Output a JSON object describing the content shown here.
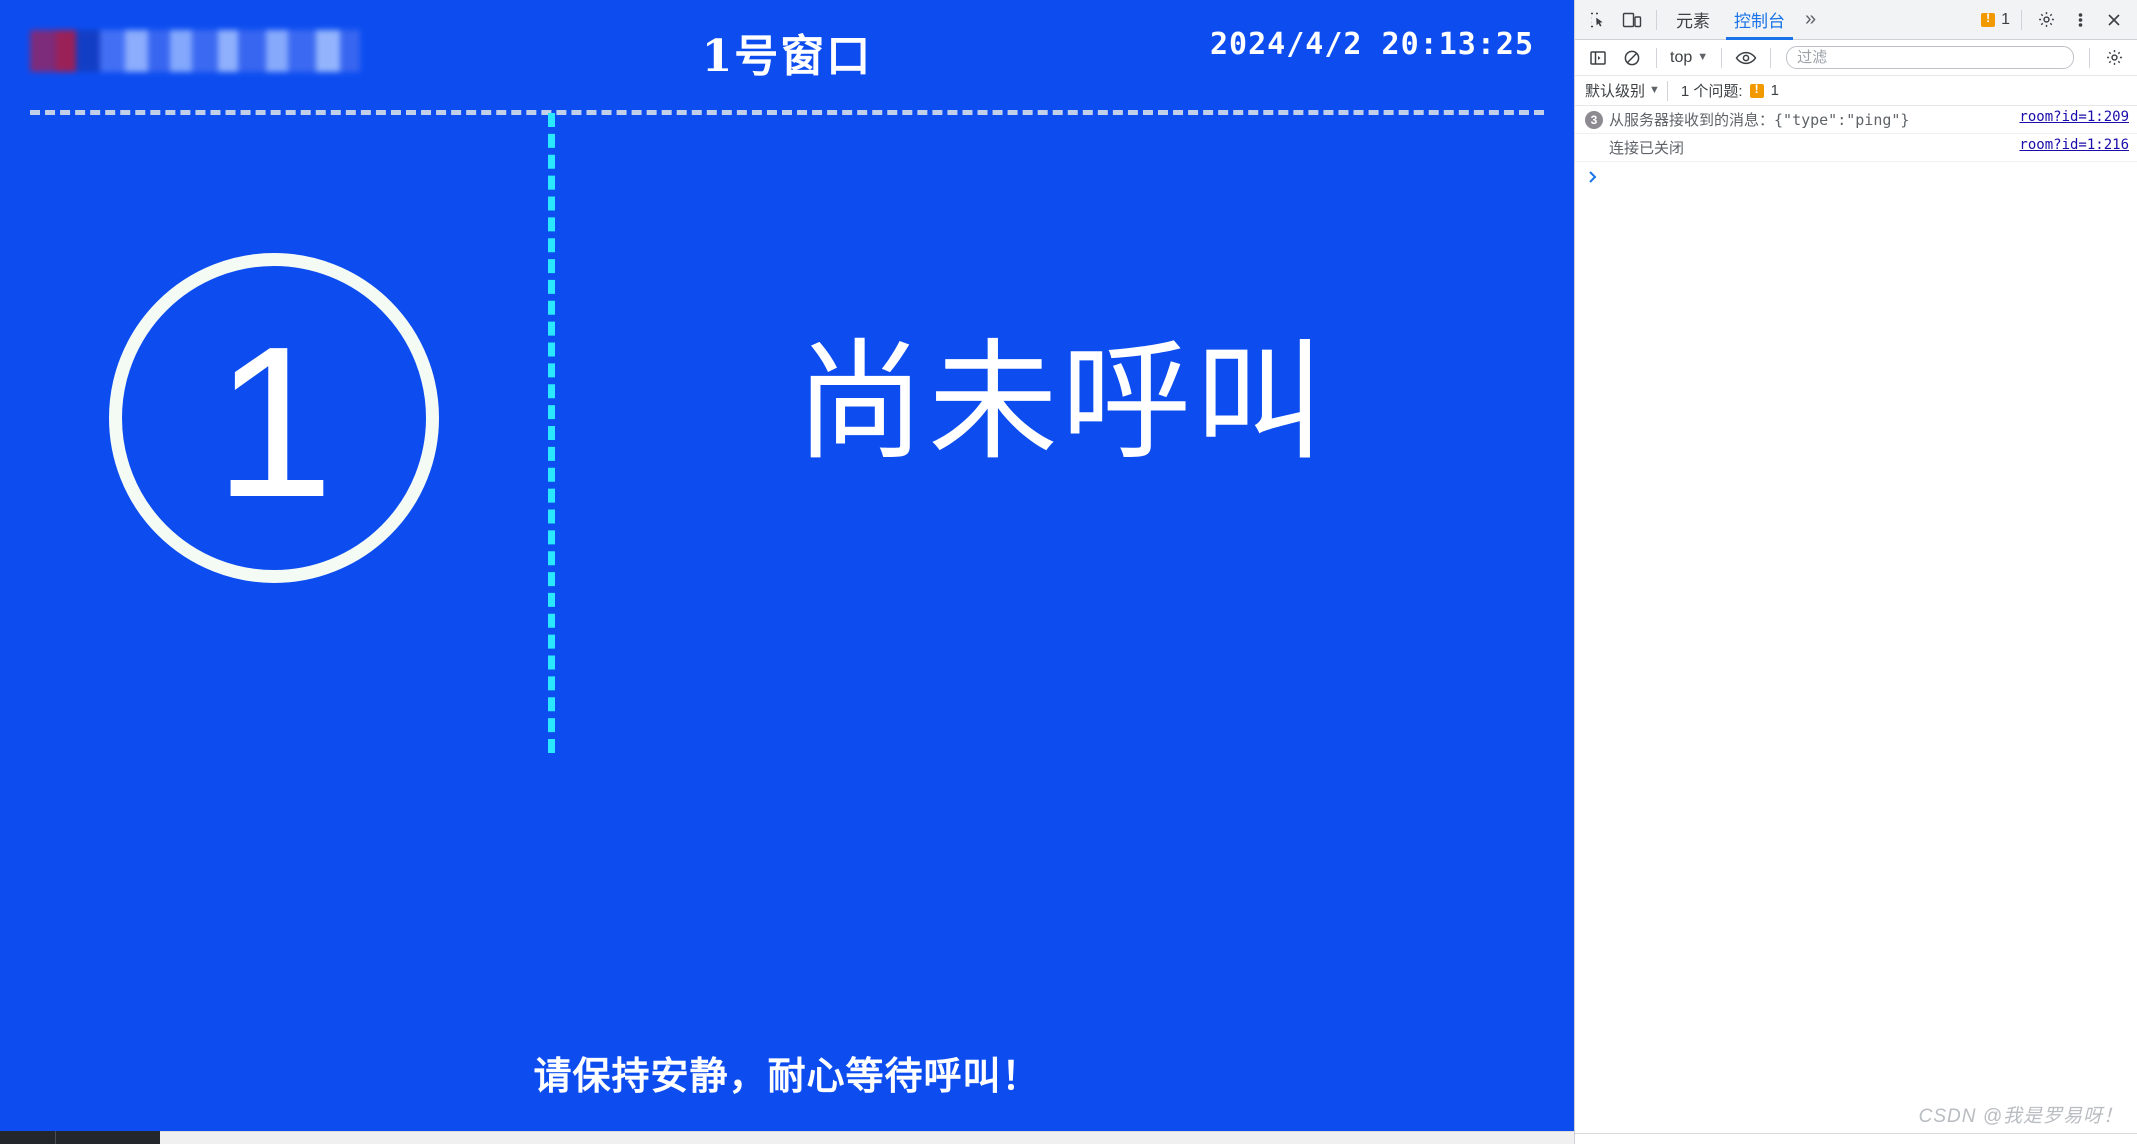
{
  "kiosk": {
    "logo_alt": "blurred-organization-logo",
    "title": "1号窗口",
    "clock": "2024/4/2 20:13:25",
    "queue_number": "1",
    "status_text": "尚未呼叫",
    "footer_notice": "请保持安静，耐心等待呼叫！",
    "colors": {
      "background": "#0d4df0",
      "text": "#ffffff",
      "divider_vertical": "#2ae8ff",
      "divider_horizontal": "#c2cfe8"
    }
  },
  "devtools": {
    "tabbar": {
      "inspect_icon": "inspect-element-icon",
      "device_icon": "device-toolbar-icon",
      "tabs": [
        {
          "label": "元素",
          "active": false
        },
        {
          "label": "控制台",
          "active": true
        }
      ],
      "more_tabs": "»",
      "warning_count": "1",
      "settings_icon": "gear-icon",
      "menu_icon": "kebab-menu-icon",
      "close_icon": "close-icon"
    },
    "toolbar": {
      "sidebar_icon": "show-console-sidebar-icon",
      "clear_icon": "clear-console-icon",
      "context_label": "top",
      "eye_icon": "live-expression-icon",
      "filter_placeholder": "过滤",
      "filter_value": "",
      "settings_icon": "gear-icon"
    },
    "levelbar": {
      "level_label": "默认级别",
      "issues_label": "1 个问题:",
      "issues_count": "1"
    },
    "console_messages": [
      {
        "repeat": "3",
        "text": "从服务器接收到的消息：{\"type\":\"ping\"}",
        "source": "room?id=1:209"
      },
      {
        "repeat": "",
        "text": "连接已关闭",
        "source": "room?id=1:216"
      }
    ],
    "prompt_symbol": "›"
  },
  "watermark": "CSDN @我是罗易呀！"
}
